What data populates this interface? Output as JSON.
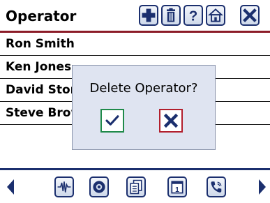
{
  "header": {
    "title": "Operator",
    "toolbar": [
      {
        "name": "add-icon"
      },
      {
        "name": "trash-icon"
      },
      {
        "name": "help-icon"
      },
      {
        "name": "home-icon"
      },
      {
        "name": "close-icon"
      }
    ]
  },
  "operators": [
    {
      "label": "Ron Smith"
    },
    {
      "label": "Ken Jones"
    },
    {
      "label": "David Stone"
    },
    {
      "label": "Steve Brown"
    },
    {
      "label": ""
    }
  ],
  "dialog": {
    "title": "Delete Operator?",
    "confirm_icon": "checkmark-icon",
    "cancel_icon": "close-icon"
  },
  "footer": {
    "buttons": [
      {
        "name": "waveform-icon"
      },
      {
        "name": "badge-icon"
      },
      {
        "name": "documents-icon"
      },
      {
        "name": "calendar-icon"
      },
      {
        "name": "phone-icon"
      }
    ]
  },
  "colors": {
    "accent_red": "#8c1c28",
    "accent_navy": "#1b2f6e",
    "dialog_bg": "#dfe4f1",
    "confirm_green": "#1f8a4a",
    "cancel_red": "#b21f2d"
  }
}
